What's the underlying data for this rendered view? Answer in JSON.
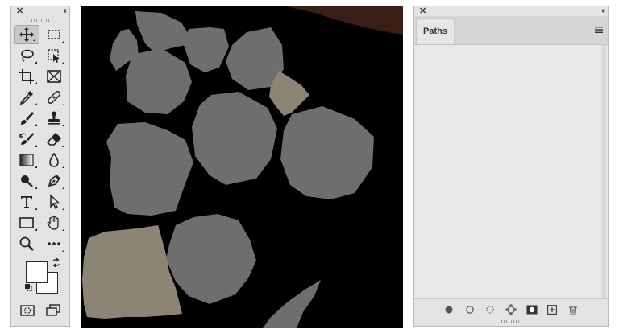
{
  "tools_panel": {
    "tools": [
      {
        "name": "move-tool",
        "icon": "move-icon",
        "selected": true
      },
      {
        "name": "rectangular-marquee-tool",
        "icon": "marquee-icon",
        "selected": false
      },
      {
        "name": "lasso-tool",
        "icon": "lasso-icon",
        "selected": false
      },
      {
        "name": "object-selection-tool",
        "icon": "object-select-icon",
        "selected": false
      },
      {
        "name": "crop-tool",
        "icon": "crop-icon",
        "selected": false
      },
      {
        "name": "frame-tool",
        "icon": "frame-icon",
        "selected": false
      },
      {
        "name": "eyedropper-tool",
        "icon": "eyedropper-icon",
        "selected": false
      },
      {
        "name": "healing-brush-tool",
        "icon": "bandage-icon",
        "selected": false
      },
      {
        "name": "brush-tool",
        "icon": "brush-icon",
        "selected": false
      },
      {
        "name": "clone-stamp-tool",
        "icon": "stamp-icon",
        "selected": false
      },
      {
        "name": "history-brush-tool",
        "icon": "history-brush-icon",
        "selected": false
      },
      {
        "name": "eraser-tool",
        "icon": "eraser-icon",
        "selected": false
      },
      {
        "name": "gradient-tool",
        "icon": "gradient-icon",
        "selected": false
      },
      {
        "name": "blur-tool",
        "icon": "drop-icon",
        "selected": false
      },
      {
        "name": "dodge-tool",
        "icon": "dodge-icon",
        "selected": false
      },
      {
        "name": "pen-tool",
        "icon": "pen-icon",
        "selected": false
      },
      {
        "name": "type-tool",
        "icon": "type-icon",
        "label": "T",
        "selected": false
      },
      {
        "name": "path-selection-tool",
        "icon": "arrow-icon",
        "selected": false
      },
      {
        "name": "rectangle-tool",
        "icon": "rectangle-icon",
        "selected": false
      },
      {
        "name": "hand-tool",
        "icon": "hand-icon",
        "selected": false
      },
      {
        "name": "zoom-tool",
        "icon": "zoom-icon",
        "selected": false
      },
      {
        "name": "more-tools",
        "icon": "ellipsis-icon",
        "label": "•••",
        "selected": false
      }
    ],
    "foreground_color": "#ffffff",
    "background_color": "#ffffff"
  },
  "paths_panel": {
    "tab_label": "Paths",
    "footer_buttons": [
      {
        "name": "fill-path-button",
        "icon": "filled-circle-icon"
      },
      {
        "name": "stroke-path-button",
        "icon": "hollow-circle-icon"
      },
      {
        "name": "load-selection-button",
        "icon": "dotted-circle-icon"
      },
      {
        "name": "make-work-path-button",
        "icon": "work-path-icon"
      },
      {
        "name": "add-mask-button",
        "icon": "mask-icon"
      },
      {
        "name": "new-path-button",
        "icon": "plus-icon"
      },
      {
        "name": "delete-path-button",
        "icon": "trash-icon"
      }
    ]
  },
  "canvas": {
    "background": "#000000",
    "shape_color": "#6e6e6e",
    "highlight_color": "#8c8474",
    "brown_corner": "#3a1e16"
  }
}
